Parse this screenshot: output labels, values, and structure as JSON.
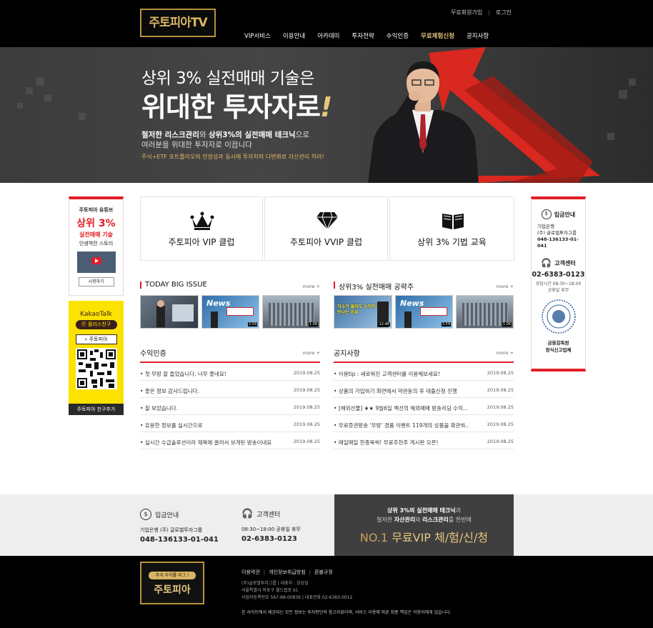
{
  "header": {
    "logo": "주토피아TV",
    "util": [
      "무료회원가입",
      "로그인"
    ],
    "nav": [
      {
        "label": "VIP서비스",
        "highlight": false
      },
      {
        "label": "이용안내",
        "highlight": false
      },
      {
        "label": "아카데미",
        "highlight": false
      },
      {
        "label": "투자전략",
        "highlight": false
      },
      {
        "label": "수익인증",
        "highlight": false
      },
      {
        "label": "무료체험신청",
        "highlight": true
      },
      {
        "label": "공지사항",
        "highlight": false
      }
    ]
  },
  "hero": {
    "line1": "상위 3% 실전매매 기술은",
    "line2_main": "위대한 투자자로",
    "line2_mark": "!",
    "line3_a": "철저한 리스크관리",
    "line3_b": "와 ",
    "line3_c": "상위3%의 실전매매 테크닉",
    "line3_d": "으로",
    "line4": "여러분을 위대한 투자자로 이끕니다",
    "line5": "주식+ETF 포트폴리오의 안정성과 동시에 투자처의 다변화로 자산관리 하라!"
  },
  "left_banner": {
    "title": "주토피아 유튜브",
    "big": "상위 3%",
    "sub_red": "실전매매 기술",
    "sub": "인생역전 스토리",
    "button": "시청하기"
  },
  "kakao": {
    "brand": "KakaoTalk",
    "plus": "플러스친구",
    "search": "주토피아",
    "footer": "주토피아 친구추가"
  },
  "right_banner": {
    "deposit_title": "입금안내",
    "deposit_bank": "기업은행",
    "deposit_holder": "(주) 글로벌투자그룹",
    "deposit_account": "048-136133-01-041",
    "cs_title": "고객센터",
    "cs_phone": "02-6383-0123",
    "cs_hours_1": "상담시간 08:30~18:00",
    "cs_hours_2": "공휴일 휴무",
    "fss_1": "금융감독원",
    "fss_2": "정식신고업체"
  },
  "cards": [
    {
      "label": "주토피아 VIP 클럽",
      "icon": "crown-icon"
    },
    {
      "label": "주토피아 VVIP 클럽",
      "icon": "diamond-icon"
    },
    {
      "label": "상위 3% 기법 교육",
      "icon": "book-icon"
    }
  ],
  "today_issue": {
    "title": "TODAY BIG  ISSUE",
    "more": "more +",
    "durations": [
      "",
      "3:59",
      "1:06"
    ]
  },
  "strategy": {
    "title": "상위3% 실전매매 공략주",
    "more": "more +",
    "thumb1_caption": "지수가 올라도 수익이 안나는 이유",
    "durations": [
      "12:48",
      "3:59",
      "1:06"
    ]
  },
  "profit": {
    "title": "수익인증",
    "more": "more +",
    "items": [
      {
        "text": "첫 무방 잘 들었습니다. 너무 좋네요!",
        "date": "2019.08.25"
      },
      {
        "text": "좋은 정보 감사드립니다.",
        "date": "2019.08.25"
      },
      {
        "text": "잘 보았습니다.",
        "date": "2019.08.25"
      },
      {
        "text": "유용한 정보를 실시간으로",
        "date": "2019.08.25"
      },
      {
        "text": "실시간 수급솔루션이라 제목에 끌려서 보게된 방송이네요",
        "date": "2019.08.25"
      }
    ]
  },
  "notice": {
    "title": "공지사항",
    "more": "more +",
    "items": [
      {
        "text": "이용tip : 새로워진 고객센터를 이용해보세요!",
        "date": "2019.08.25"
      },
      {
        "text": "상품의 가입하기 화면에서 약관동의 후 대출신청 진행",
        "date": "2019.08.25"
      },
      {
        "text": "[해외선물] ★★ 9월6일 백선의 해외매매 방송리딩 수익...",
        "date": "2019.08.25"
      },
      {
        "text": "무료증권방송 '무방' 경품 이벤트 119개의 상품을 확관하..",
        "date": "2019.08.25"
      },
      {
        "text": "매일매일 한종목씩! 무료추천주 게시판 오픈!",
        "date": "2019.08.25"
      }
    ]
  },
  "infobar": {
    "deposit_title": "입금안내",
    "deposit_line": "기업은행 (주) 글로벌투자그룹",
    "deposit_account": "048-136133-01-041",
    "cs_title": "고객센터",
    "cs_line": "08:30~18:00 공휴일 휴무",
    "cs_phone": "02-6383-0123",
    "promo_1a": "상위 3%의 실전매매 테크닉",
    "promo_1b": "과",
    "promo_2a": "철저한 ",
    "promo_2b": "자산관리",
    "promo_2c": "와 ",
    "promo_2d": "리스크관리",
    "promo_2e": "를 한번에",
    "promo_no": "NO.1",
    "promo_main": "무료VIP 체/험/신/청"
  },
  "footer": {
    "logo_small": "주식 수익률 리그 !",
    "logo_big": "주토피아",
    "links": [
      "이용약관",
      "개인정보취급방침",
      "환불규정"
    ],
    "addr_1": "(주)글로벌투자그룹  |  대표자 : 강상일",
    "addr_2": "서울특별시 마포구 월드컵로 61",
    "addr_3": "사업자등록번호 567-88-00836  |  대표전화 02-6383-0012",
    "note": "본 사이트에서 제공되는 모든 정보는 투자판단의 참고자료이며, 서비스 이용에 따른 최종 책임은 이용자에게 있습니다."
  },
  "colors": {
    "red": "#e21d24",
    "gold": "#d9b563",
    "kakao": "#fbe200",
    "dark": "#3f3f3f"
  }
}
